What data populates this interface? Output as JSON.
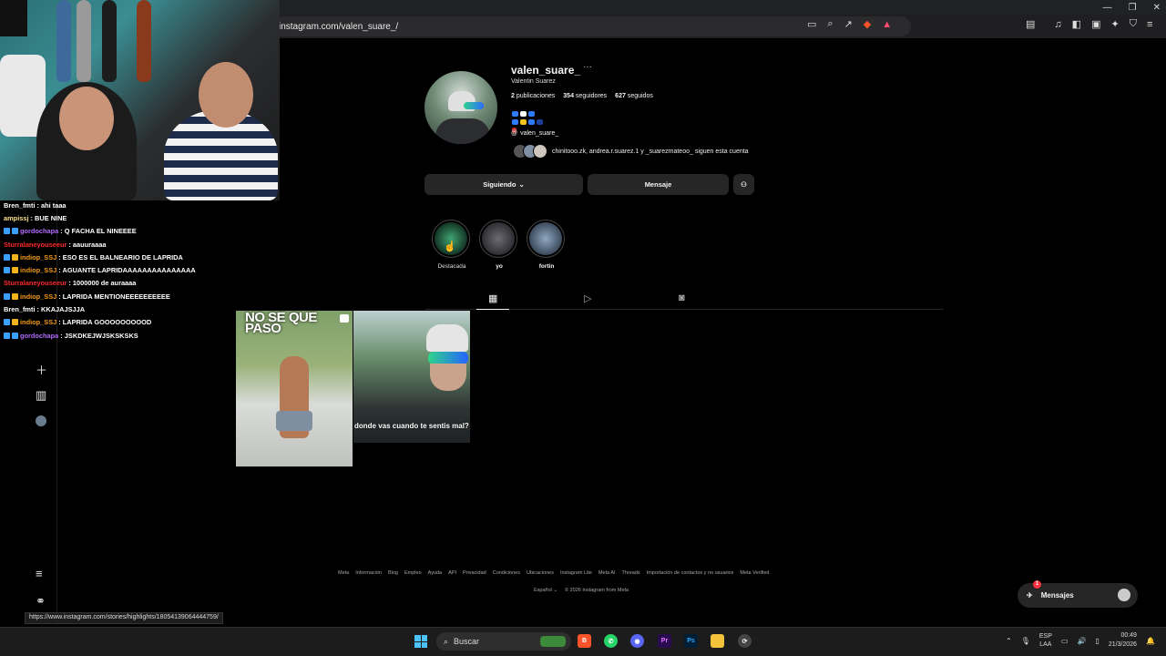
{
  "browser": {
    "url": "instagram.com/valen_suare_/",
    "status_url": "https://www.instagram.com/stories/highlights/18054139064444759/"
  },
  "stream_chat": [
    {
      "user": "Bren_fmti",
      "text": ": ahi taaa",
      "color": "#ffffff",
      "badge": ""
    },
    {
      "user": "ampissj",
      "text": ": BUE NINE",
      "color": "#f7e08a",
      "badge": ""
    },
    {
      "user": "gordochapa",
      "text": ": Q FACHA EL NINEEEE",
      "color": "#b26bff",
      "badge": "blue"
    },
    {
      "user": "Sturralaneyouseeur",
      "text": ": aauuraaaa",
      "color": "#ff2a2a",
      "badge": ""
    },
    {
      "user": "indiop_SSJ",
      "text": ": ESO ES EL BALNEARIO DE LAPRIDA",
      "color": "#f39a1b",
      "badge": "yellow"
    },
    {
      "user": "indiop_SSJ",
      "text": ": AGUANTE LAPRIDAAAAAAAAAAAAAAA",
      "color": "#f39a1b",
      "badge": "yellow"
    },
    {
      "user": "Sturralaneyouseeur",
      "text": ": 1000000 de auraaaa",
      "color": "#ff2a2a",
      "badge": ""
    },
    {
      "user": "indiop_SSJ",
      "text": ": LAPRIDA MENTIONEEEEEEEEEE",
      "color": "#f39a1b",
      "badge": "yellow"
    },
    {
      "user": "Bren_fmti",
      "text": ": KKAJAJSJJA",
      "color": "#ffffff",
      "badge": ""
    },
    {
      "user": "indiop_SSJ",
      "text": ": LAPRIDA GOOOOOOOOOD",
      "color": "#f39a1b",
      "badge": "yellow"
    },
    {
      "user": "gordochapa",
      "text": ": JSKDKEJWJSKSKSKS",
      "color": "#b26bff",
      "badge": "blue"
    }
  ],
  "profile": {
    "username": "valen_suare_",
    "full_name": "Valentin Suarez",
    "posts_count": "2",
    "posts_label": "publicaciones",
    "followers_count": "354",
    "followers_label": "seguidores",
    "following_count": "627",
    "following_label": "seguidos",
    "threads_handle": "valen_suare_",
    "followed_by_text": "chinitooo.zk, andrea.r.suarez.1 y _suarezmateoo_ siguen esta cuenta"
  },
  "buttons": {
    "following": "Siguiendo",
    "message": "Mensaje"
  },
  "highlights": [
    {
      "label": "Destacada",
      "bold": false,
      "color": "#1f4a35"
    },
    {
      "label": "yo",
      "bold": true,
      "color": "#4a4a50"
    },
    {
      "label": "fortin",
      "bold": true,
      "color": "#6a7c8f"
    }
  ],
  "posts": {
    "post1_title": "NO SE QUE PASO",
    "post2_caption": "donde vas cuando te sentis mal?"
  },
  "footer": {
    "links": [
      "Meta",
      "Información",
      "Blog",
      "Empleo",
      "Ayuda",
      "API",
      "Privacidad",
      "Condiciones",
      "Ubicaciones",
      "Instagram Lite",
      "Meta AI",
      "Threads",
      "Importación de contactos y no usuarios",
      "Meta Verified"
    ],
    "language": "Español",
    "copyright": "© 2026 Instagram from Meta"
  },
  "messages_button": {
    "label": "Mensajes",
    "badge": "1"
  },
  "taskbar": {
    "search_label": "Buscar",
    "lang_line1": "ESP",
    "lang_line2": "LAA",
    "time": "00:49",
    "date": "21/3/2026"
  }
}
